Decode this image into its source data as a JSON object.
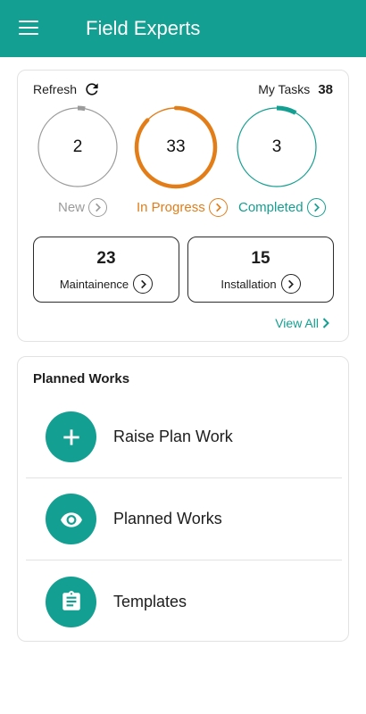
{
  "app": {
    "title": "Field Experts",
    "accent_color": "#139f91"
  },
  "summary": {
    "refresh_label": "Refresh",
    "my_tasks_label": "My Tasks",
    "my_tasks_count": "38",
    "statuses": [
      {
        "label": "New",
        "count": "2",
        "color": "#9b9b9b",
        "progress": 0.03
      },
      {
        "label": "In Progress",
        "count": "33",
        "color": "#e27d18",
        "progress": 0.87
      },
      {
        "label": "Completed",
        "count": "3",
        "color": "#139f91",
        "progress": 0.08
      }
    ],
    "categories": [
      {
        "label": "Maintainence",
        "count": "23"
      },
      {
        "label": "Installation",
        "count": "15"
      }
    ],
    "view_all_label": "View All"
  },
  "planned": {
    "title": "Planned Works",
    "items": [
      {
        "label": "Raise Plan Work",
        "icon": "plus-icon"
      },
      {
        "label": "Planned Works",
        "icon": "eye-icon"
      },
      {
        "label": "Templates",
        "icon": "clipboard-icon"
      }
    ]
  }
}
